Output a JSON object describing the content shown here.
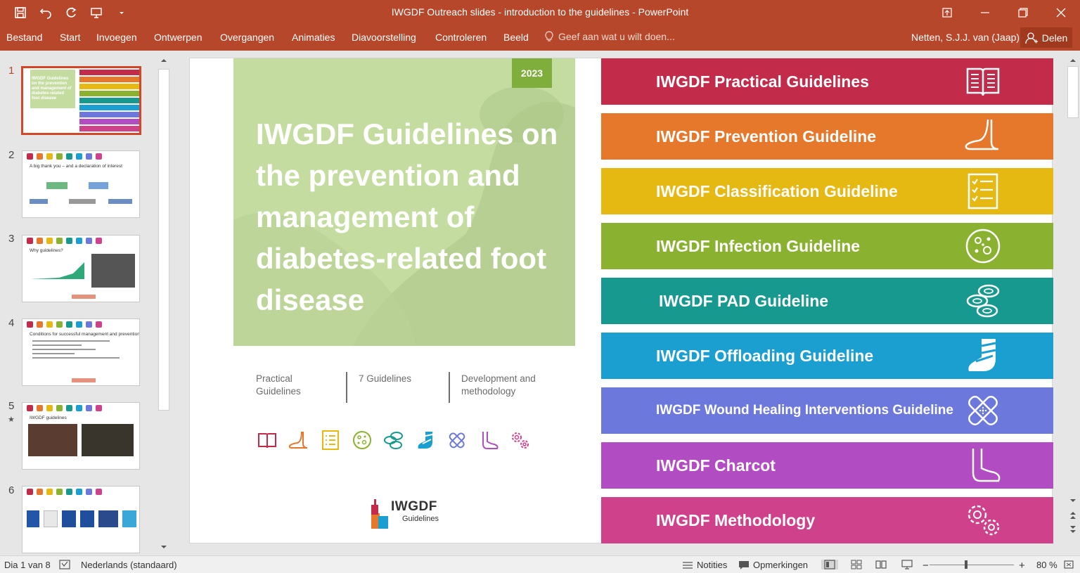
{
  "titlebar": {
    "title": "IWGDF Outreach slides - introduction to the guidelines - PowerPoint"
  },
  "ribbon": {
    "tabs": [
      "Bestand",
      "Start",
      "Invoegen",
      "Ontwerpen",
      "Overgangen",
      "Animaties",
      "Diavoorstelling",
      "Controleren",
      "Beeld"
    ],
    "tell_me": "Geef aan wat u wilt doen...",
    "user": "Netten, S.J.J. van (Jaap)",
    "share": "Delen"
  },
  "thumbnails": [
    {
      "number": "1",
      "selected": true
    },
    {
      "number": "2",
      "title": "A big thank you – and a declaration of interest"
    },
    {
      "number": "3",
      "title": "Why guidelines?"
    },
    {
      "number": "4",
      "title": "Conditions for successful management and prevention"
    },
    {
      "number": "5",
      "title": "IWGDF guidelines"
    },
    {
      "number": "6",
      "title": ""
    }
  ],
  "slide": {
    "year": "2023",
    "title": "IWGDF Guidelines on the prevention and management of diabetes-related foot disease",
    "info": [
      "Practical Guidelines",
      "7 Guidelines",
      "Development and methodology"
    ],
    "logo": {
      "name": "IWGDF",
      "sub": "Guidelines"
    },
    "bands": [
      {
        "label": "IWGDF Practical Guidelines",
        "color": "#c22b4a",
        "icon": "book-icon"
      },
      {
        "label": "IWGDF Prevention Guideline",
        "color": "#e6782b",
        "icon": "foot-icon"
      },
      {
        "label": "IWGDF Classification Guideline",
        "color": "#e5b812",
        "icon": "checklist-icon"
      },
      {
        "label": "IWGDF Infection Guideline",
        "color": "#8ab230",
        "icon": "bacteria-icon"
      },
      {
        "label": "IWGDF PAD Guideline",
        "color": "#17998f",
        "icon": "blood-cells-icon"
      },
      {
        "label": "IWGDF Offloading Guideline",
        "color": "#1a9fd0",
        "icon": "cast-icon"
      },
      {
        "label": "IWGDF Wound Healing Interventions Guideline",
        "color": "#6c78dc",
        "icon": "bandage-icon"
      },
      {
        "label": "IWGDF Charcot",
        "color": "#b24cc2",
        "icon": "charcot-foot-icon"
      },
      {
        "label": "IWGDF Methodology",
        "color": "#d0418c",
        "icon": "gears-icon"
      }
    ]
  },
  "statusbar": {
    "slide_indicator": "Dia 1 van 8",
    "language": "Nederlands (standaard)",
    "notes": "Notities",
    "comments": "Opmerkingen",
    "zoom_minus": "−",
    "zoom_plus": "+",
    "zoom": "80 %"
  }
}
